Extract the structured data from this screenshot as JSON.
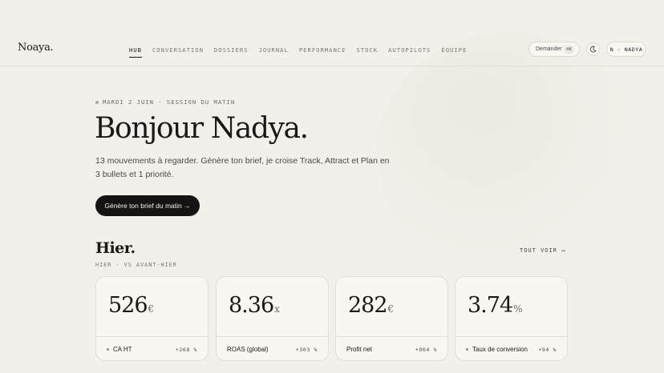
{
  "brand": {
    "logo": "Noaya."
  },
  "nav": {
    "items": [
      {
        "label": "HUB",
        "active": true
      },
      {
        "label": "CONVERSATION",
        "active": false
      },
      {
        "label": "DOSSIERS",
        "active": false
      },
      {
        "label": "JOURNAL",
        "active": false
      },
      {
        "label": "PERFORMANCE",
        "active": false
      },
      {
        "label": "STOCK",
        "active": false
      },
      {
        "label": "AUTOPILOTS",
        "active": false
      },
      {
        "label": "ÉQUIPE",
        "active": false
      }
    ]
  },
  "header": {
    "ask_label": "Demander",
    "ask_shortcut": "⌘K",
    "theme_icon": "moon-icon",
    "user_label": "N · NADYA"
  },
  "hero": {
    "eyebrow": "MARDI 2 JUIN · SESSION DU MATIN",
    "title": "Bonjour Nadya.",
    "subtitle": "13 mouvements à regarder. Génère ton brief, je croise Track, Attract et Plan en 3 bullets et 1 priorité.",
    "cta_label": "Génère ton brief du matin →"
  },
  "yesterday": {
    "title": "Hier.",
    "subtitle": "HIER · VS AVANT-HIER",
    "see_all": "TOUT VOIR ⟶",
    "cards": [
      {
        "value": "526",
        "unit": "€",
        "label": "CA HT",
        "delta": "+268 %",
        "marker": true
      },
      {
        "value": "8.36",
        "unit": "x",
        "label": "ROAS (global)",
        "delta": "+303 %",
        "marker": false
      },
      {
        "value": "282",
        "unit": "€",
        "label": "Profit net",
        "delta": "+904 %",
        "marker": false
      },
      {
        "value": "3.74",
        "unit": "%",
        "label": "Taux de conversion",
        "delta": "+94 %",
        "marker": true
      }
    ]
  },
  "colors": {
    "background": "#f2f0ea",
    "ink": "#1a1917",
    "cta": "#151412"
  }
}
